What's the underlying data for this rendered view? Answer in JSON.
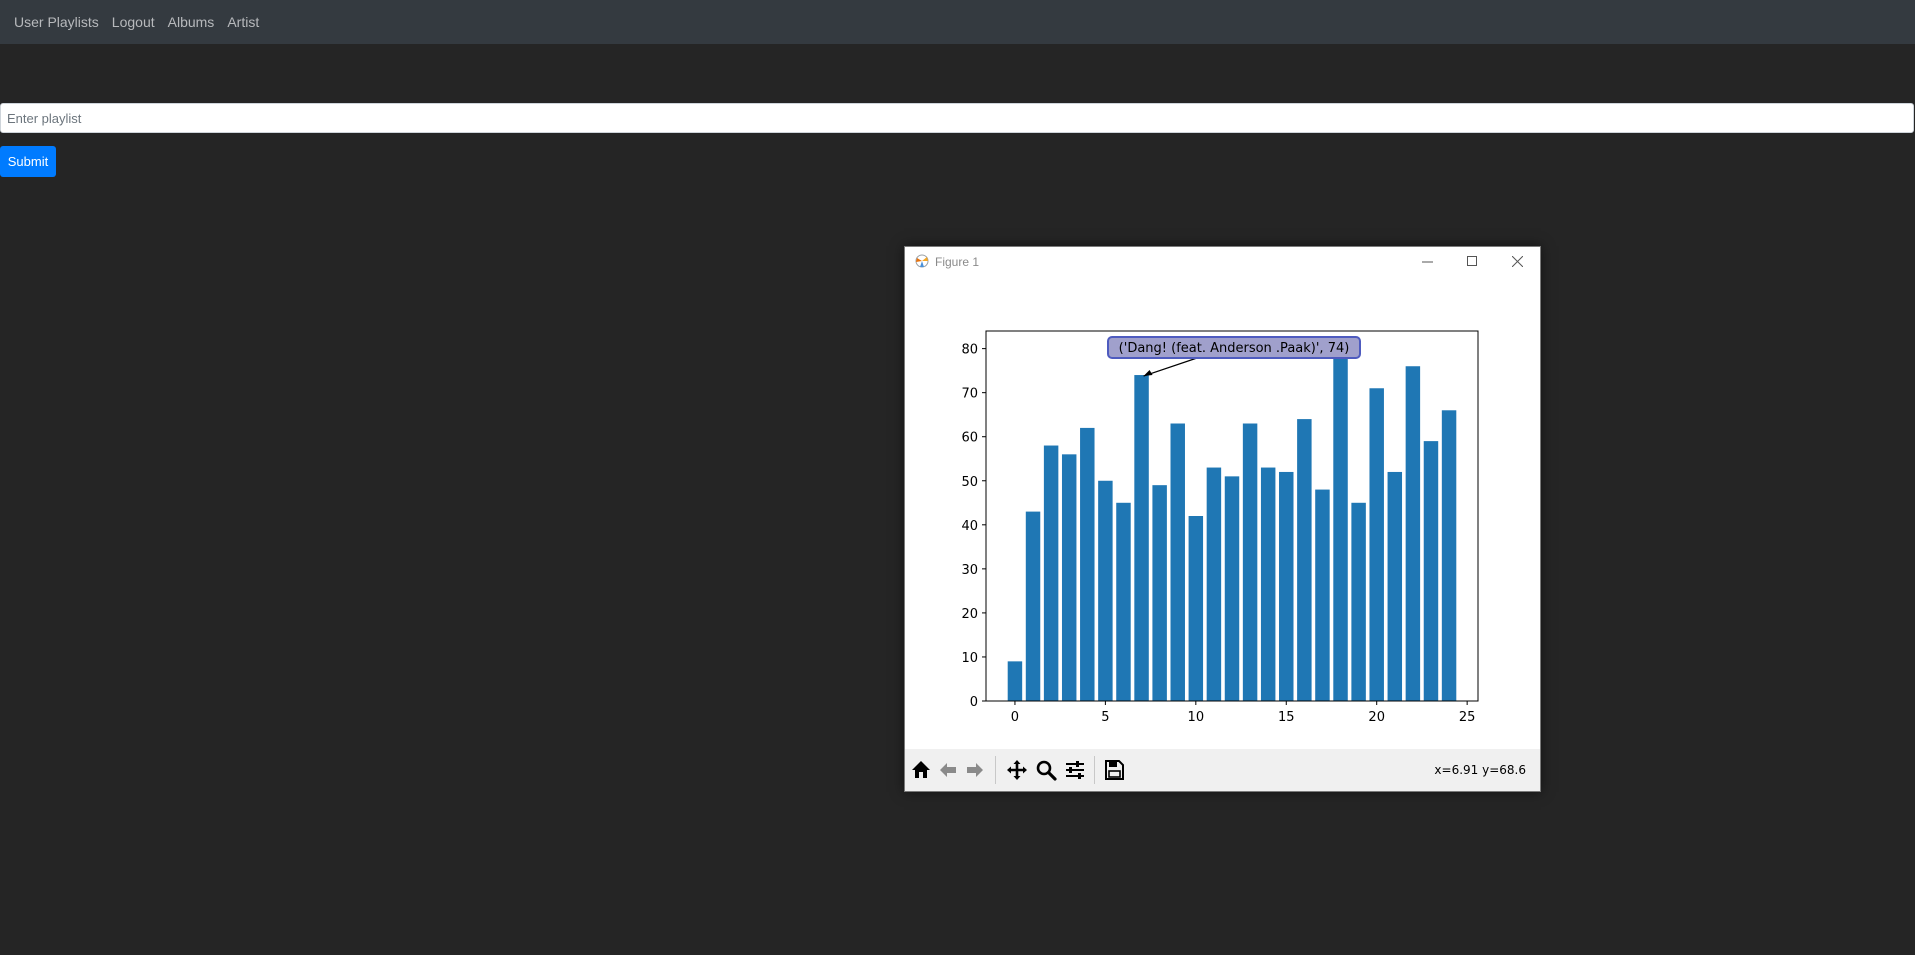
{
  "navbar": {
    "items": [
      {
        "label": "User Playlists"
      },
      {
        "label": "Logout"
      },
      {
        "label": "Albums"
      },
      {
        "label": "Artist"
      }
    ]
  },
  "form": {
    "playlist_placeholder": "Enter playlist",
    "submit_label": "Submit"
  },
  "figure_window": {
    "title": "Figure 1",
    "coordinates_readout": "x=6.91 y=68.6",
    "annotation": "('Dang! (feat. Anderson .Paak)', 74)",
    "annotation_index": 7
  },
  "chart_data": {
    "type": "bar",
    "x": [
      0,
      1,
      2,
      3,
      4,
      5,
      6,
      7,
      8,
      9,
      10,
      11,
      12,
      13,
      14,
      15,
      16,
      17,
      18,
      19,
      20,
      21,
      22,
      23,
      24
    ],
    "values": [
      9,
      43,
      58,
      56,
      62,
      50,
      45,
      74,
      49,
      63,
      42,
      53,
      51,
      63,
      53,
      52,
      64,
      48,
      80,
      45,
      71,
      52,
      76,
      59,
      66
    ],
    "bar_color": "#1f77b4",
    "xlim": [
      -1.6,
      25.6
    ],
    "ylim": [
      0,
      84
    ],
    "xticks": [
      0,
      5,
      10,
      15,
      20,
      25
    ],
    "yticks": [
      0,
      10,
      20,
      30,
      40,
      50,
      60,
      70,
      80
    ],
    "grid": false,
    "legend": false
  }
}
